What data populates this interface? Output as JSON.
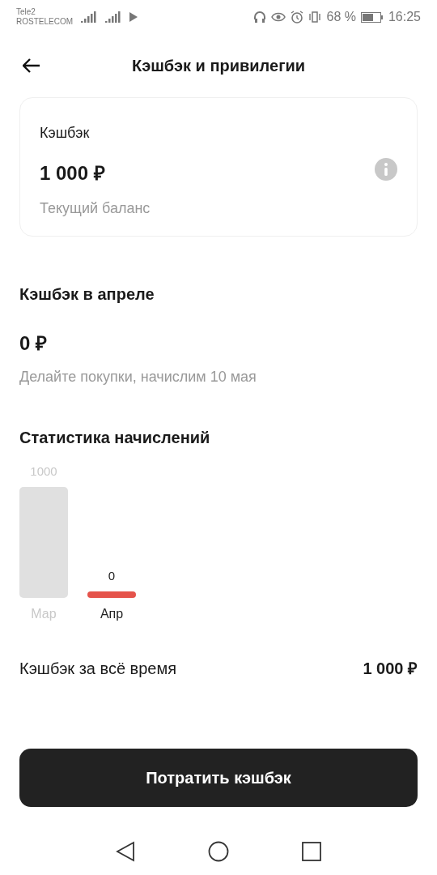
{
  "status_bar": {
    "carrier_1": "Tele2",
    "carrier_2": "ROSTELECOM",
    "battery": "68 %",
    "time": "16:25"
  },
  "header": {
    "title": "Кэшбэк и привилегии"
  },
  "balance_card": {
    "title": "Кэшбэк",
    "amount": "1 000 ₽",
    "caption": "Текущий баланс"
  },
  "month": {
    "title": "Кэшбэк в апреле",
    "amount": "0 ₽",
    "note": "Делайте покупки, начислим 10 мая"
  },
  "statistics": {
    "title": "Статистика начислений",
    "chart_data": {
      "type": "bar",
      "categories": [
        "Мар",
        "Апр"
      ],
      "series": [
        {
          "color": "#e0e0e0",
          "values": [
            1000,
            null
          ]
        },
        {
          "color": "#e5534b",
          "values": [
            null,
            0
          ]
        }
      ],
      "data_labels": true
    }
  },
  "total": {
    "label": "Кэшбэк за всё время",
    "value": "1 000 ₽"
  },
  "spend_button": "Потратить кэшбэк"
}
